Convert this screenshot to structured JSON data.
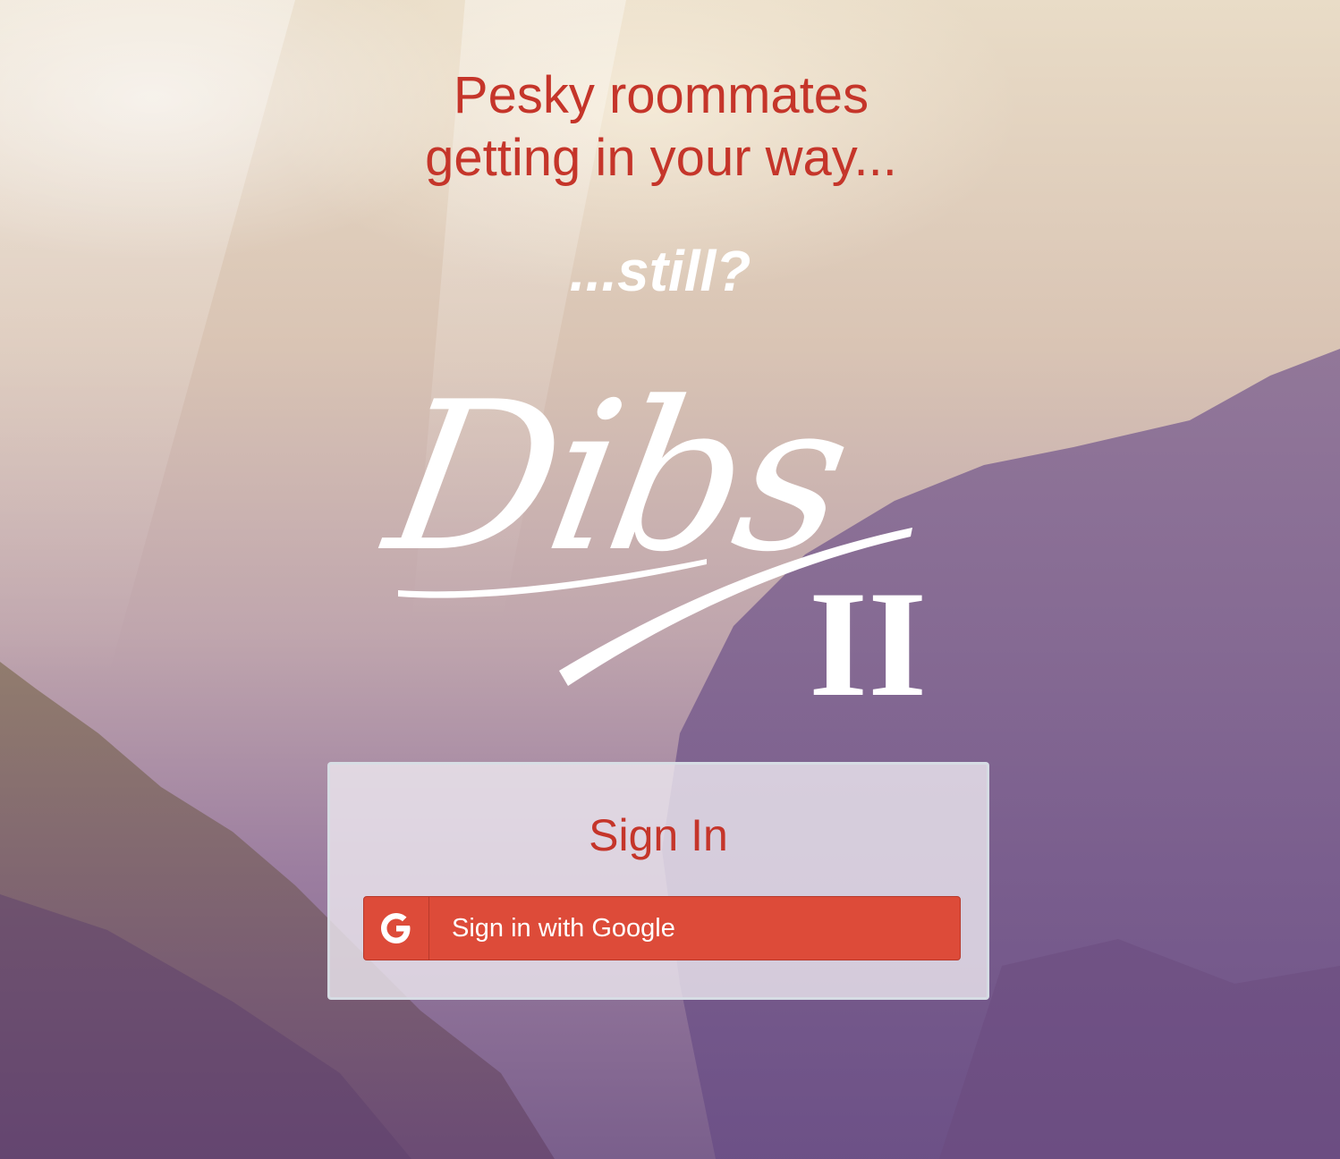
{
  "hero": {
    "headline_line1": "Pesky roommates",
    "headline_line2": "getting in your way...",
    "tagline": "...still?"
  },
  "logo": {
    "script_text": "Dibs",
    "numeral_text": "II"
  },
  "signin": {
    "title": "Sign In",
    "google_button_label": "Sign in with Google",
    "google_icon": "google-g-icon"
  },
  "colors": {
    "accent_red": "#c5352a",
    "google_button": "#dd4b39",
    "logo_text": "#ffffff"
  }
}
